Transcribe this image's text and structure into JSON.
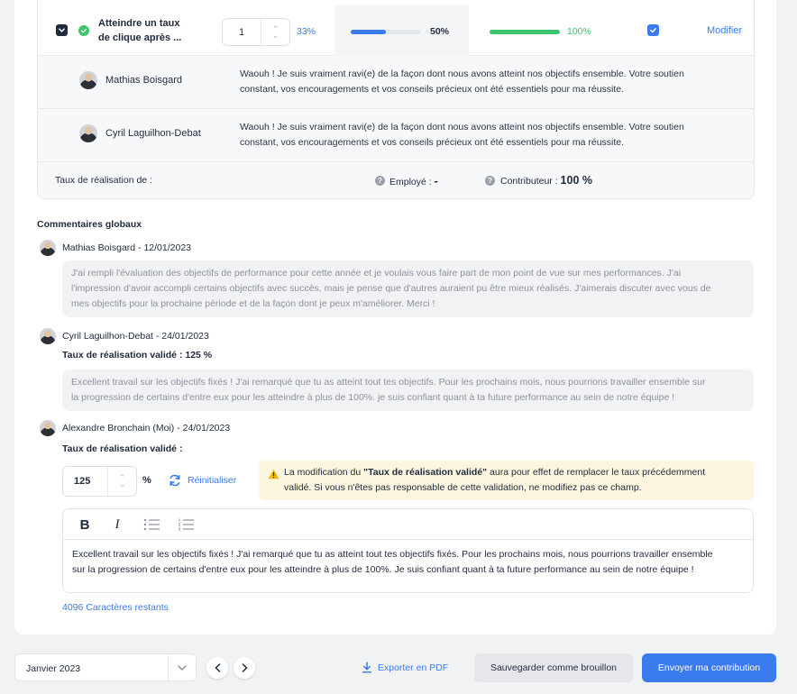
{
  "objective": {
    "title_line1": "Atteindre un taux",
    "title_line2": "de clique après ...",
    "weight_value": "1",
    "weight_pct": "33%",
    "employee_progress": 0.5,
    "employee_pct": "50%",
    "contributor_progress": 1.0,
    "contributor_pct": "100%",
    "edit_label": "Modifier"
  },
  "objective_comments": [
    {
      "author": "Mathias Boisgard",
      "line1": "Waouh ! Je suis vraiment ravi(e) de la façon dont nous avons atteint nos objectifs ensemble. Votre soutien",
      "line2": "constant, vos encouragements et vos conseils précieux ont été essentiels pour ma réussite."
    },
    {
      "author": "Cyril Laguilhon-Debat",
      "line1": "Waouh ! Je suis vraiment ravi(e) de la façon dont nous avons atteint nos objectifs ensemble. Votre soutien",
      "line2": "constant, vos encouragements et vos conseils précieux ont été essentiels pour ma réussite."
    }
  ],
  "rate_row": {
    "label": "Taux de réalisation de :",
    "employee_label": "Employé : ",
    "employee_value": "-",
    "contributor_label": "Contributeur : ",
    "contributor_value": "100 %"
  },
  "global_comments": {
    "title": "Commentaires globaux",
    "items": [
      {
        "author": "Mathias Boisgard - 12/01/2023",
        "line1": "J'ai rempli l'évaluation des objectifs de performance pour cette année et je voulais vous faire part de mon point de vue sur mes performances. J'ai",
        "line2": "l'impression d'avoir accompli certains objectifs avec succès, mais je pense que d'autres auraient pu être mieux réalisés. J'aimerais discuter avec vous de",
        "line3": "mes objectifs pour la prochaine période et de la façon dont je peux m'améliorer. Merci !"
      },
      {
        "author": "Cyril Laguilhon-Debat - 24/01/2023",
        "validated": "Taux de réalisation validé :  125 %",
        "line1": "Excellent travail sur les objectifs fixés ! J'ai remarqué que tu as atteint tout tes objectifs. Pour les prochains mois, nous pourrions travailler ensemble sur",
        "line2": "la progression de certains d'entre eux pour les atteindre à plus de 100%. je suis confiant quant à ta future performance au sein de notre équipe !"
      }
    ],
    "me": {
      "author": "Alexandre Bronchain (Moi) - 24/01/2023",
      "validated_label": "Taux de réalisation validé :",
      "rate_value": "125",
      "pct_sign": "%",
      "reset_label": "Réinitialiser",
      "warning_prefix": "La modification du ",
      "warning_bold": "\"Taux de réalisation validé\"",
      "warning_suffix": " aura pour effet de remplacer le taux précédemment",
      "warning_line2": "validé. Si vous n'êtes pas responsable de cette validation, ne modifiez pas ce champ.",
      "editor_line1": "Excellent travail sur les objectifs fixés ! J'ai remarqué que tu as atteint tout tes objectifs fixés. Pour les prochains mois, nous pourrions travailler ensemble",
      "editor_line2": "sur la progression de certains d'entre eux pour les atteindre à plus de 100%. Je suis confiant quant à ta future performance au sein de notre équipe !",
      "remaining": "4096 Caractères restants"
    }
  },
  "footer": {
    "month": "Janvier 2023",
    "export_label": "Exporter en PDF",
    "draft_label": "Sauvegarder comme brouillon",
    "send_label": "Envoyer ma contribution"
  },
  "colors": {
    "accent": "#3b7bf0",
    "success": "#3ec46d",
    "checkbox_dark": "#1f2a3d"
  }
}
